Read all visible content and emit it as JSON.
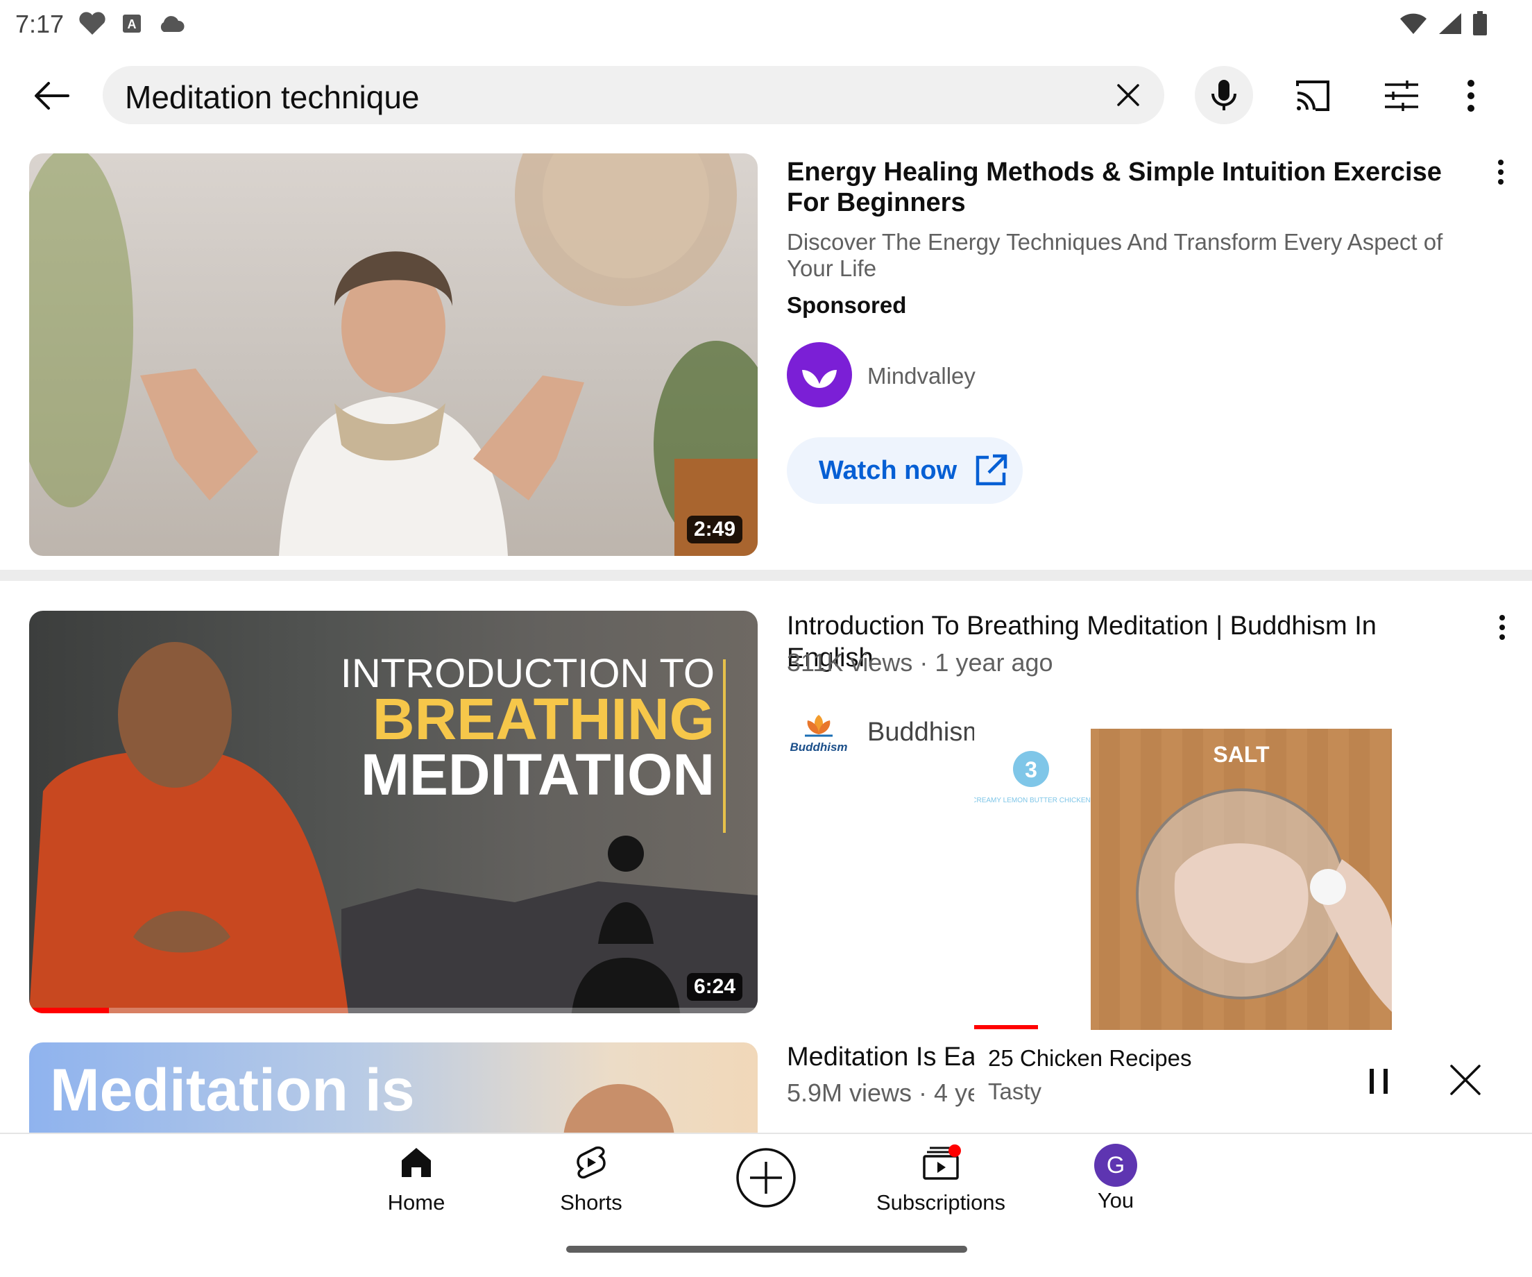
{
  "status": {
    "time": "7:17"
  },
  "search": {
    "query": "Meditation technique"
  },
  "ad": {
    "title": "Energy Healing Methods & Simple Intuition Exercise For Beginners",
    "description": "Discover The Energy Techniques And Transform Every Aspect of Your Life",
    "sponsored": "Sponsored",
    "channel": "Mindvalley",
    "cta": "Watch now",
    "duration": "2:49"
  },
  "videos": [
    {
      "title": "Introduction To Breathing Meditation | Buddhism In English",
      "meta": "311K views · 1 year ago",
      "channel": "Buddhism",
      "channel_logo_text": "Buddhism",
      "duration": "6:24",
      "thumb_text": [
        "INTRODUCTION TO",
        "BREATHING",
        "MEDITATION"
      ]
    },
    {
      "title": "Meditation Is Ea:",
      "meta": "5.9M views · 4 ye",
      "thumb_text": "Meditation is"
    }
  ],
  "miniplayer": {
    "title": "25 Chicken Recipes",
    "channel": "Tasty",
    "step_number": "3",
    "step_caption": "CREAMY LEMON BUTTER CHICKEN",
    "overlay_text": "SALT"
  },
  "nav": {
    "home": "Home",
    "shorts": "Shorts",
    "subscriptions": "Subscriptions",
    "you": "You",
    "avatar_letter": "G"
  },
  "colors": {
    "accent_red": "#ff0000",
    "link_blue": "#065fd4",
    "mindvalley_purple": "#7b1fd6",
    "avatar_purple": "#5e35b1"
  }
}
